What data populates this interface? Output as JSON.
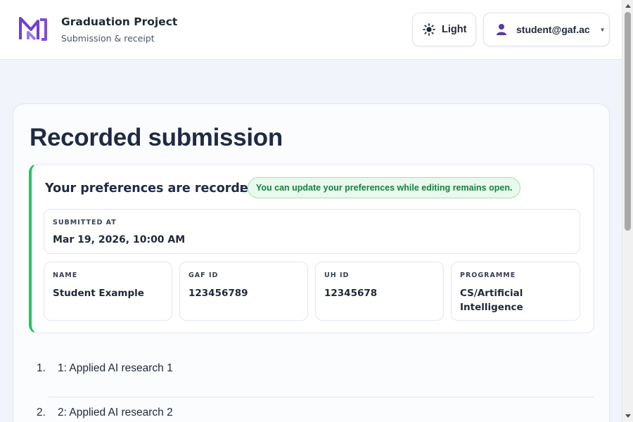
{
  "header": {
    "title": "Graduation Project",
    "subtitle": "Submission & receipt",
    "theme_label": "Light",
    "user_email": "student@gaf.ac"
  },
  "card": {
    "title": "Recorded submission",
    "notice": {
      "heading": "Your preferences are recorded",
      "colon": ":",
      "badge": "You can update your preferences while editing remains open."
    },
    "submitted": {
      "label": "SUBMITTED AT",
      "value": "Mar 19, 2026, 10:00 AM"
    },
    "fields": [
      {
        "label": "NAME",
        "value": "Student Example"
      },
      {
        "label": "GAF ID",
        "value": "123456789"
      },
      {
        "label": "UH ID",
        "value": "12345678"
      },
      {
        "label": "PROGRAMME",
        "value": "CS/Artificial Intelligence"
      }
    ],
    "preferences": [
      {
        "num": "1.",
        "text": "1: Applied AI research 1"
      },
      {
        "num": "2.",
        "text": "2: Applied AI research 2"
      }
    ]
  },
  "colors": {
    "accent_green": "#22c55e",
    "badge_text": "#15803d",
    "logo_purple": "#7c4ddb"
  }
}
